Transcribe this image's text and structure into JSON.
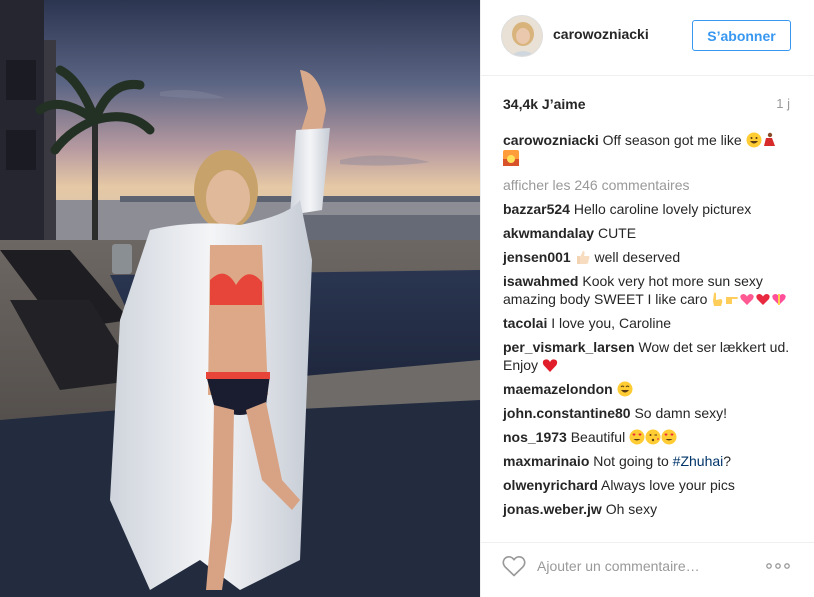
{
  "post": {
    "username": "carowozniacki",
    "follow_label": "S’abonner",
    "likes": "34,4k J’aime",
    "time_ago": "1 j",
    "caption_user": "carowozniacki",
    "caption_text": "Off season got me like",
    "view_all_label": "afficher les 246 commentaires"
  },
  "comments": [
    {
      "user": "bazzar524",
      "text": "Hello caroline lovely picturex"
    },
    {
      "user": "akwmandalay",
      "text": "CUTE"
    },
    {
      "user": "jensen001",
      "text": "well deserved"
    },
    {
      "user": "isawahmed",
      "text": "Kook very hot more sun sexy amazing body SWEET I like caro"
    },
    {
      "user": "tacolai",
      "text": "I love you, Caroline"
    },
    {
      "user": "per_vismark_larsen",
      "text": "Wow det ser lækkert ud. Enjoy"
    },
    {
      "user": "maemazelondon",
      "text": ""
    },
    {
      "user": "john.constantine80",
      "text": "So damn sexy!"
    },
    {
      "user": "nos_1973",
      "text": "Beautiful"
    },
    {
      "user": "maxmarinaio",
      "text": "Not going to",
      "hashtag": "#Zhuhai",
      "suffix": "?"
    },
    {
      "user": "olwenyrichard",
      "text": "Always love your pics"
    },
    {
      "user": "jonas.weber.jw",
      "text": "Oh sexy"
    }
  ],
  "footer": {
    "comment_placeholder": "Ajouter un commentaire…",
    "more_icon": "ellipsis-icon",
    "like_icon": "heart-outline-icon"
  },
  "colors": {
    "accent": "#3897f0",
    "muted": "#999999",
    "text": "#262626",
    "hashtag": "#003569"
  }
}
